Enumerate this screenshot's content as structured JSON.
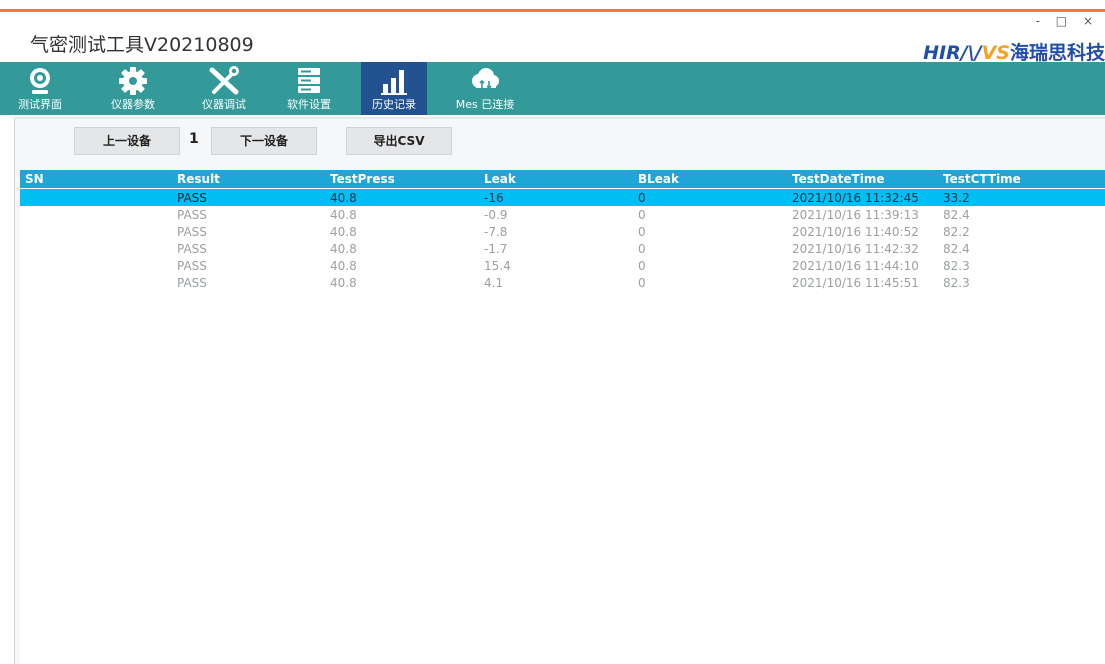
{
  "window": {
    "title": "气密测试工具V20210809",
    "controls": [
      "-",
      "□",
      "×"
    ],
    "brand_latin_1": "HIR",
    "brand_latin_2": "VS",
    "brand_cn": "海瑞思科技"
  },
  "toolbar": {
    "items": [
      {
        "label": "测试界面",
        "icon": "camera-icon"
      },
      {
        "label": "仪器参数",
        "icon": "gear-icon"
      },
      {
        "label": "仪器调试",
        "icon": "tools-icon"
      },
      {
        "label": "软件设置",
        "icon": "server-icon"
      },
      {
        "label": "历史记录",
        "icon": "bar-chart-icon",
        "active": true
      },
      {
        "label": "Mes 已连接",
        "icon": "cloud-icon"
      }
    ]
  },
  "controls": {
    "prev_device": "上一设备",
    "device_index": "1",
    "next_device": "下一设备",
    "export_csv": "导出CSV"
  },
  "table": {
    "columns": [
      "SN",
      "Result",
      "TestPress",
      "Leak",
      "BLeak",
      "TestDateTime",
      "TestCTTime"
    ],
    "rows": [
      [
        "",
        "PASS",
        "40.8",
        "-16",
        "0",
        "2021/10/16 11:32:45",
        "33.2"
      ],
      [
        "",
        "PASS",
        "40.8",
        "-0.9",
        "0",
        "2021/10/16 11:39:13",
        "82.4"
      ],
      [
        "",
        "PASS",
        "40.8",
        "-7.8",
        "0",
        "2021/10/16 11:40:52",
        "82.2"
      ],
      [
        "",
        "PASS",
        "40.8",
        "-1.7",
        "0",
        "2021/10/16 11:42:32",
        "82.4"
      ],
      [
        "",
        "PASS",
        "40.8",
        "15.4",
        "0",
        "2021/10/16 11:44:10",
        "82.3"
      ],
      [
        "",
        "PASS",
        "40.8",
        "4.1",
        "0",
        "2021/10/16 11:45:51",
        "82.3"
      ]
    ],
    "selected_row": 0
  },
  "colors": {
    "toolbar_bg": "#339999",
    "active_tab": "#22528f",
    "header_bg": "#1ea6d8",
    "selected_row": "#00bff3",
    "accent_line": "#ee7b3b"
  }
}
